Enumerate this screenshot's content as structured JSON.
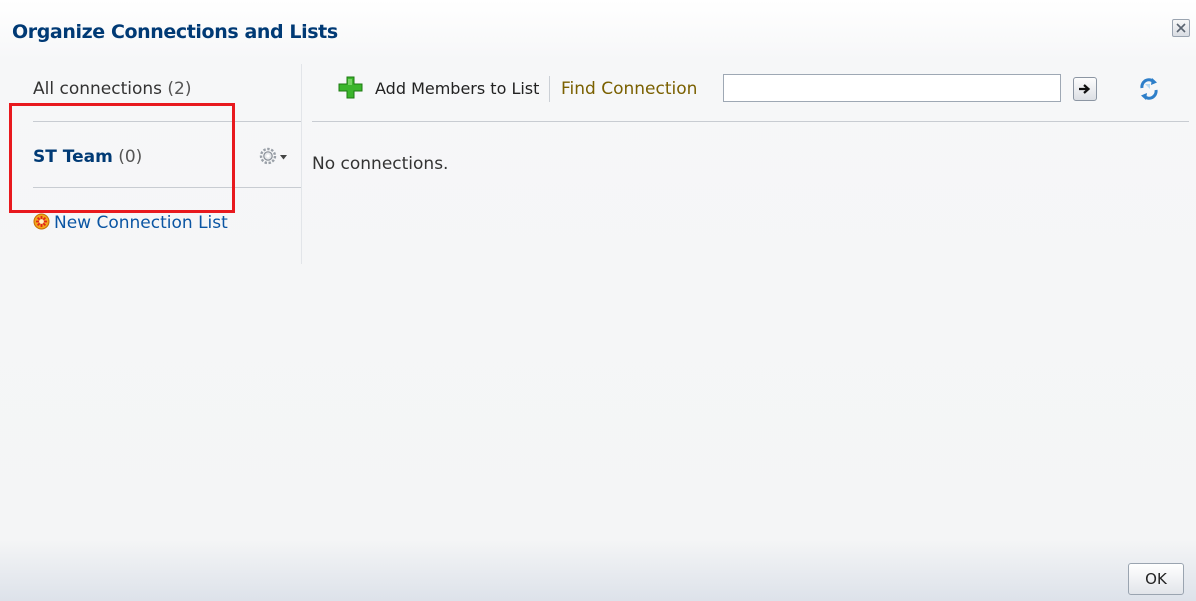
{
  "dialog": {
    "title": "Organize Connections and Lists",
    "close_icon": "close-icon"
  },
  "sidebar": {
    "all_connections": {
      "label": "All connections",
      "count": "(2)"
    },
    "lists": [
      {
        "name": "ST Team",
        "count": "(0)",
        "menu_icon": "gear-icon"
      }
    ],
    "new_list_label": "New Connection List",
    "new_list_icon": "new-star-icon"
  },
  "toolbar": {
    "add_members_label": "Add Members to List",
    "add_icon": "green-plus-icon",
    "find_label": "Find Connection",
    "find_value": "",
    "go_icon": "arrow-right-icon",
    "refresh_icon": "refresh-icon"
  },
  "content": {
    "empty_message": "No connections."
  },
  "footer": {
    "ok_label": "OK"
  },
  "colors": {
    "title": "#003a75",
    "link": "#0a55a3",
    "find_label": "#7a6000",
    "highlight": "#e8191e"
  }
}
